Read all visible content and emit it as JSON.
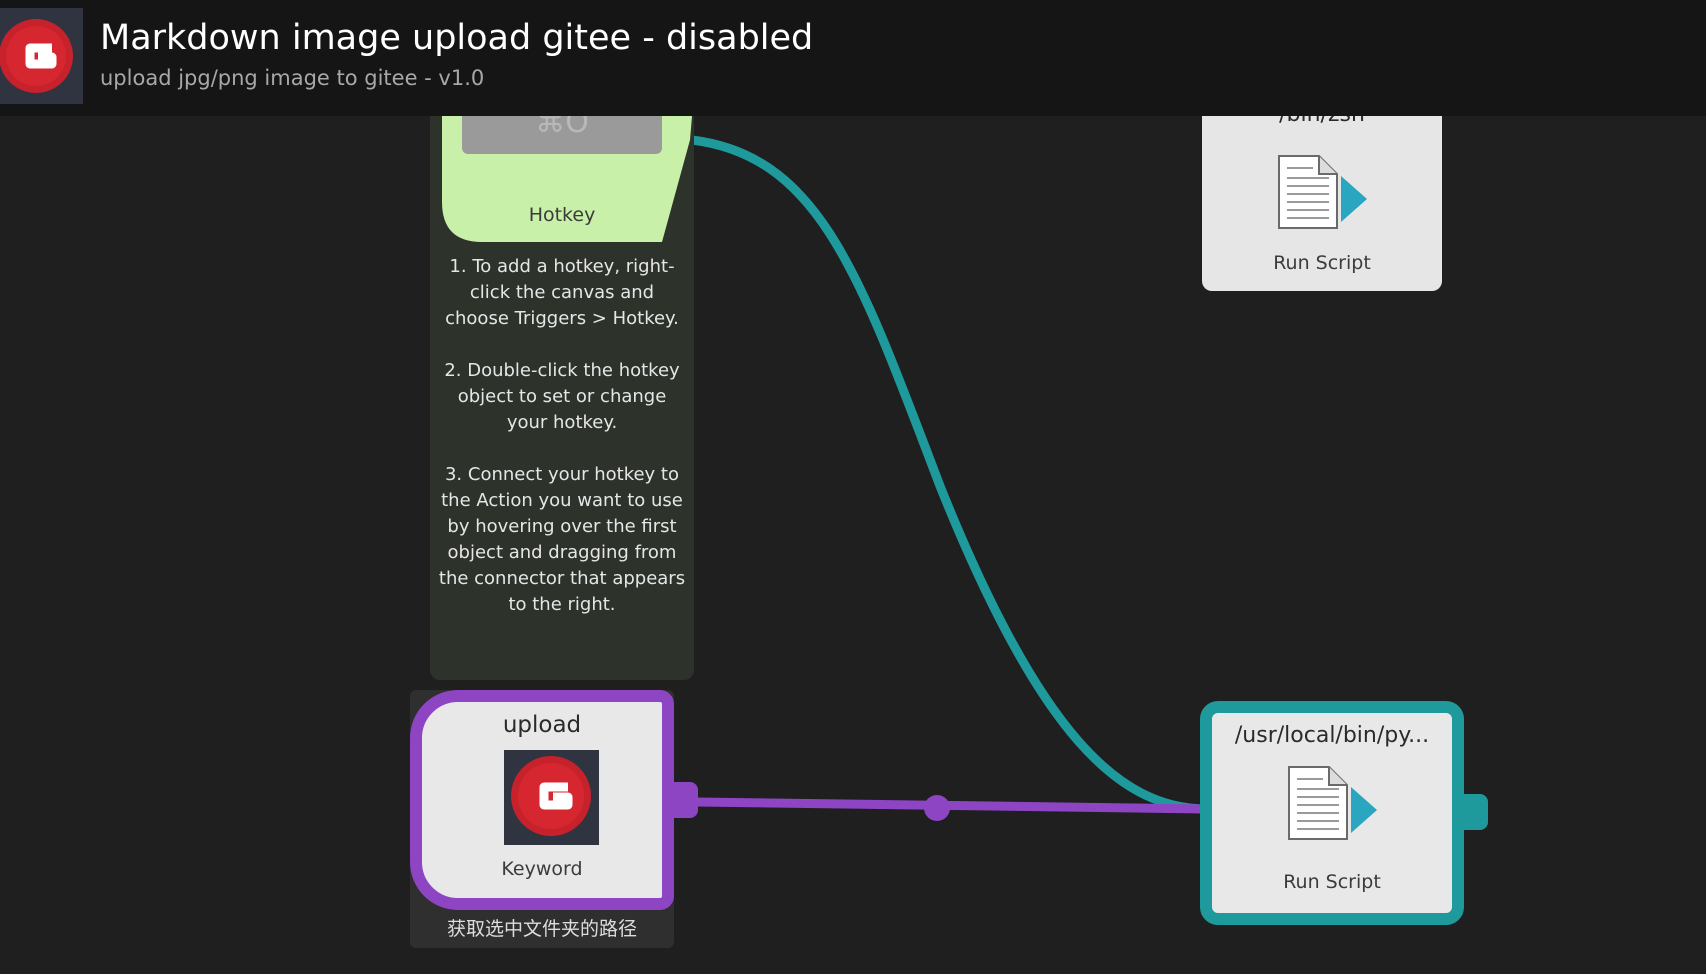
{
  "header": {
    "title": "Markdown image upload gitee - disabled",
    "subtitle": "upload jpg/png image to gitee - v1.0",
    "icon": "gitee-logo-icon"
  },
  "hotkey": {
    "key_text": "⌘O",
    "label": "Hotkey",
    "instructions": "1. To add a hotkey, right-click the canvas and choose Triggers > Hotkey.\n\n2. Double-click the hotkey object to set or change your hotkey.\n\n3. Connect your hotkey to the Action you want to use by hovering over the first object and dragging from the connector that appears to the right."
  },
  "run_script_top": {
    "path": "/bin/zsh",
    "label": "Run Script",
    "icon": "script-icon"
  },
  "keyword": {
    "title": "upload",
    "label": "Keyword",
    "caption": "获取选中文件夹的路径",
    "icon": "gitee-logo-icon"
  },
  "run_script_bottom": {
    "path": "/usr/local/bin/py...",
    "label": "Run Script",
    "icon": "script-icon"
  },
  "colors": {
    "background": "#1f1f1f",
    "header": "#151515",
    "hotkey_green": "#c8f0a8",
    "keyword_purple": "#8e45c4",
    "script_teal": "#1e9a9c",
    "gitee_red": "#c7222b"
  }
}
